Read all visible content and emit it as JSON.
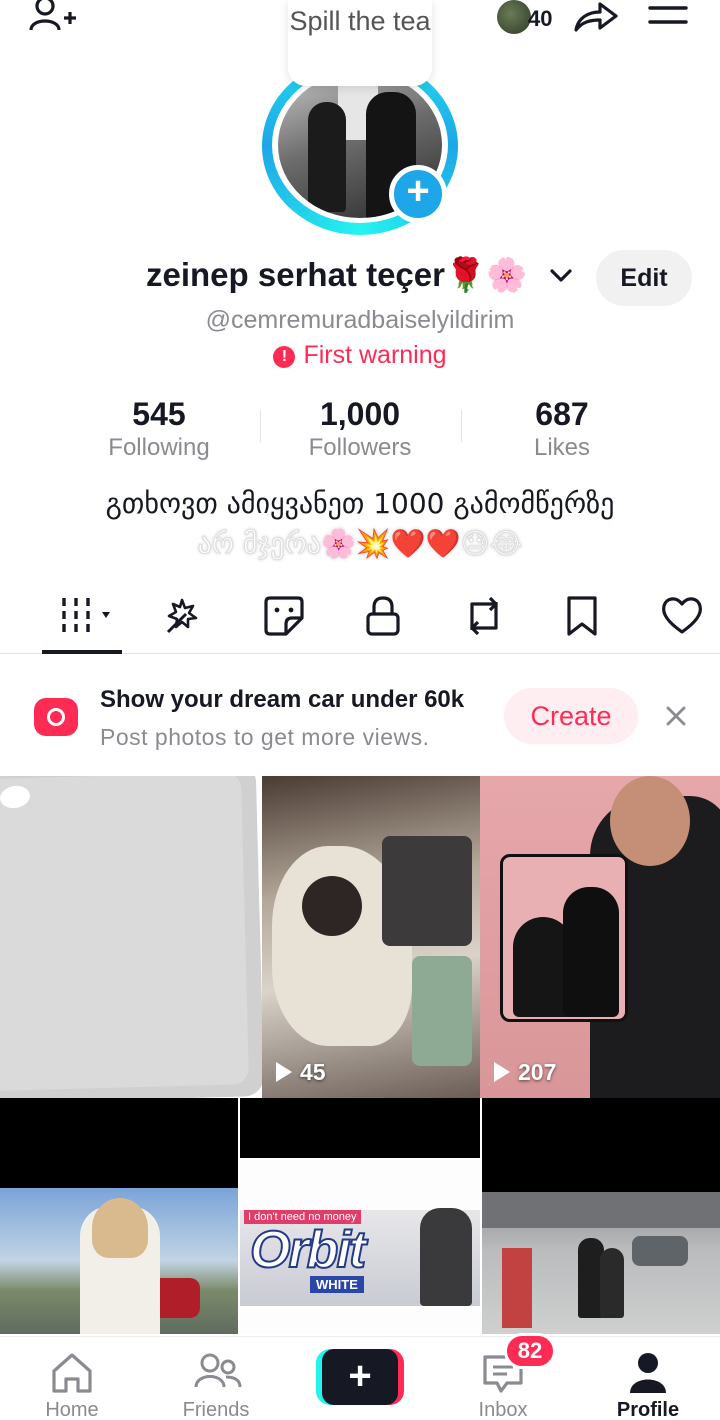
{
  "topbar": {
    "spill_text": "Spill the tea",
    "visitor_count": "40"
  },
  "profile": {
    "display_name": "zeinep serhat teçer🌹🌸",
    "edit_label": "Edit",
    "username": "@cemremuradbaiselyildirim",
    "warning_text": "First warning",
    "warning_icon": "!"
  },
  "stats": {
    "following": {
      "value": "545",
      "label": "Following"
    },
    "followers": {
      "value": "1,000",
      "label": "Followers"
    },
    "likes": {
      "value": "687",
      "label": "Likes"
    }
  },
  "bio": {
    "line1": "გთხოვთ ამიყვანეთ 1000 გამომწერზე",
    "line2": "არ მჯერა🌸💥❤️❤️😓😂"
  },
  "tabs": [
    "videos",
    "reposts-sparkle",
    "stickers",
    "private",
    "repost",
    "saved",
    "liked"
  ],
  "promo": {
    "title": "Show your dream car under 60k",
    "subtitle": "Post photos to get more views.",
    "create_label": "Create"
  },
  "videos": [
    {
      "views": ""
    },
    {
      "views": "45"
    },
    {
      "views": "207"
    },
    {
      "views": ""
    },
    {
      "views": "",
      "banner_text": "Orbit",
      "banner_sub": "WHITE",
      "banner_tag": "I don't need no money"
    },
    {
      "views": ""
    }
  ],
  "nav": {
    "home": "Home",
    "friends": "Friends",
    "create_symbol": "+",
    "inbox": "Inbox",
    "inbox_badge": "82",
    "profile": "Profile"
  },
  "colors": {
    "accent": "#fe2c55",
    "cyan": "#25f4ee",
    "text": "#161823",
    "muted": "#8a8b91"
  }
}
